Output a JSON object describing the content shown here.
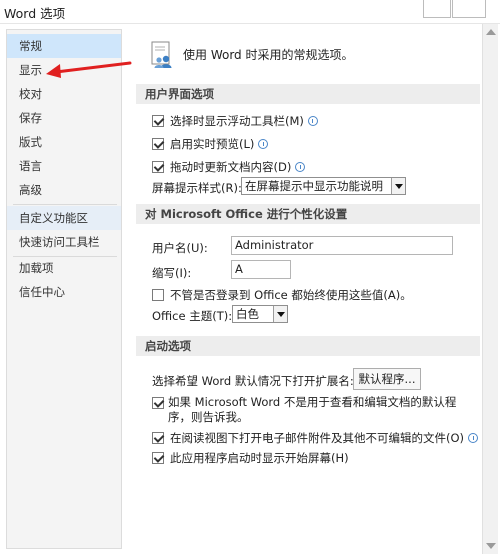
{
  "window": {
    "title": "Word 选项"
  },
  "sidebar": {
    "items": [
      {
        "label": "常规"
      },
      {
        "label": "显示"
      },
      {
        "label": "校对"
      },
      {
        "label": "保存"
      },
      {
        "label": "版式"
      },
      {
        "label": "语言"
      },
      {
        "label": "高级"
      },
      {
        "label": "自定义功能区"
      },
      {
        "label": "快速访问工具栏"
      },
      {
        "label": "加载项"
      },
      {
        "label": "信任中心"
      }
    ],
    "selected": "常规"
  },
  "main": {
    "header": "使用 Word 时采用的常规选项。",
    "ui_section": {
      "title": "用户界面选项",
      "mini_toolbar": {
        "label": "选择时显示浮动工具栏(M)",
        "checked": true
      },
      "live_preview": {
        "label": "启用实时预览(L)",
        "checked": true
      },
      "update_drag": {
        "label": "拖动时更新文档内容(D)",
        "checked": true
      },
      "screentip_label": "屏幕提示样式(R):",
      "screentip_value": "在屏幕提示中显示功能说明"
    },
    "personalize_section": {
      "title": "对 Microsoft Office 进行个性化设置",
      "username_label": "用户名(U):",
      "username_value": "Administrator",
      "initials_label": "缩写(I):",
      "initials_value": "A",
      "always_use": {
        "label": "不管是否登录到 Office 都始终使用这些值(A)。",
        "checked": false
      },
      "theme_label": "Office 主题(T):",
      "theme_value": "白色"
    },
    "startup_section": {
      "title": "启动选项",
      "extensions_label": "选择希望 Word 默认情况下打开扩展名:",
      "default_programs_button": "默认程序...",
      "tell_me": {
        "label": "如果 Microsoft Word 不是用于查看和编辑文档的默认程序，则告诉我。",
        "checked": true
      },
      "reading_view": {
        "label": "在阅读视图下打开电子邮件附件及其他不可编辑的文件(O)",
        "checked": true
      },
      "start_screen": {
        "label": "此应用程序启动时显示开始屏幕(H)",
        "checked": true
      }
    }
  },
  "colors": {
    "selected_nav": "#cfe6fb",
    "arrow": "#e02020",
    "info_icon": "#4a86c8"
  }
}
